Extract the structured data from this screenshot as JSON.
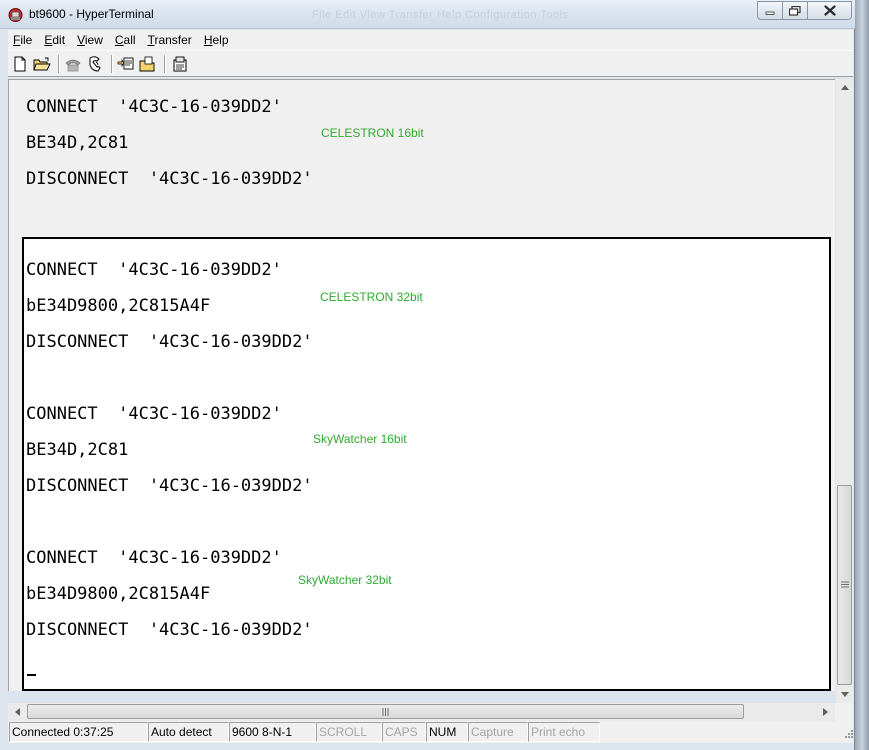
{
  "window": {
    "title": "bt9600 - HyperTerminal",
    "background_menu": "File   Edit   View   Transfer   Help   Configuration   Tools"
  },
  "menubar": {
    "items": [
      {
        "label_acc": "F",
        "label_rest": "ile"
      },
      {
        "label_acc": "E",
        "label_rest": "dit"
      },
      {
        "label_acc": "V",
        "label_rest": "iew"
      },
      {
        "label_acc": "C",
        "label_rest": "all"
      },
      {
        "label_acc": "T",
        "label_rest": "ransfer"
      },
      {
        "label_acc": "H",
        "label_rest": "elp"
      }
    ]
  },
  "toolbar": {
    "icons": [
      "new-icon",
      "open-icon",
      "disconnect-icon",
      "dial-icon",
      "send-icon",
      "receive-icon",
      "properties-icon"
    ]
  },
  "terminal": {
    "upper_lines": [
      "CONNECT  '4C3C-16-039DD2'",
      "BE34D,2C81",
      "DISCONNECT  '4C3C-16-039DD2'"
    ],
    "screen_lines": [
      "CONNECT  '4C3C-16-039DD2'",
      "bE34D9800,2C815A4F",
      "DISCONNECT  '4C3C-16-039DD2'",
      "CONNECT  '4C3C-16-039DD2'",
      "BE34D,2C81",
      "DISCONNECT  '4C3C-16-039DD2'",
      "CONNECT  '4C3C-16-039DD2'",
      "bE34D9800,2C815A4F",
      "DISCONNECT  '4C3C-16-039DD2'"
    ],
    "notes": [
      "CELESTRON 16bit",
      "CELESTRON 32bit",
      "SkyWatcher 16bit",
      "SkyWatcher 32bit"
    ],
    "note_color": "#2eaa2e"
  },
  "statusbar": {
    "connected": "Connected 0:37:25",
    "detect": "Auto detect",
    "settings": "9600 8-N-1",
    "scroll": "SCROLL",
    "caps": "CAPS",
    "num": "NUM",
    "capture": "Capture",
    "print_echo": "Print echo"
  }
}
